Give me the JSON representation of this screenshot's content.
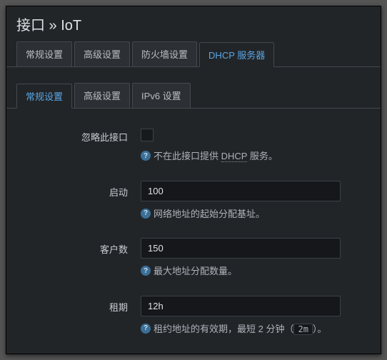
{
  "page_title": "接口 » IoT",
  "outer_tabs": [
    {
      "label": "常规设置"
    },
    {
      "label": "高级设置"
    },
    {
      "label": "防火墙设置"
    },
    {
      "label": "DHCP 服务器"
    }
  ],
  "outer_active_index": 3,
  "inner_tabs": [
    {
      "label": "常规设置"
    },
    {
      "label": "高级设置"
    },
    {
      "label": "IPv6 设置"
    }
  ],
  "inner_active_index": 0,
  "fields": {
    "ignore": {
      "label": "忽略此接口",
      "hint_prefix": "不在此接口提供 ",
      "hint_dotted": "DHCP",
      "hint_suffix": " 服务。"
    },
    "start": {
      "label": "启动",
      "value": "100",
      "hint": "网络地址的起始分配基址。"
    },
    "limit": {
      "label": "客户数",
      "value": "150",
      "hint": "最大地址分配数量。"
    },
    "lease": {
      "label": "租期",
      "value": "12h",
      "hint_prefix": "租约地址的有效期，最短 2 分钟（",
      "hint_code": "2m",
      "hint_suffix": "）。"
    }
  }
}
